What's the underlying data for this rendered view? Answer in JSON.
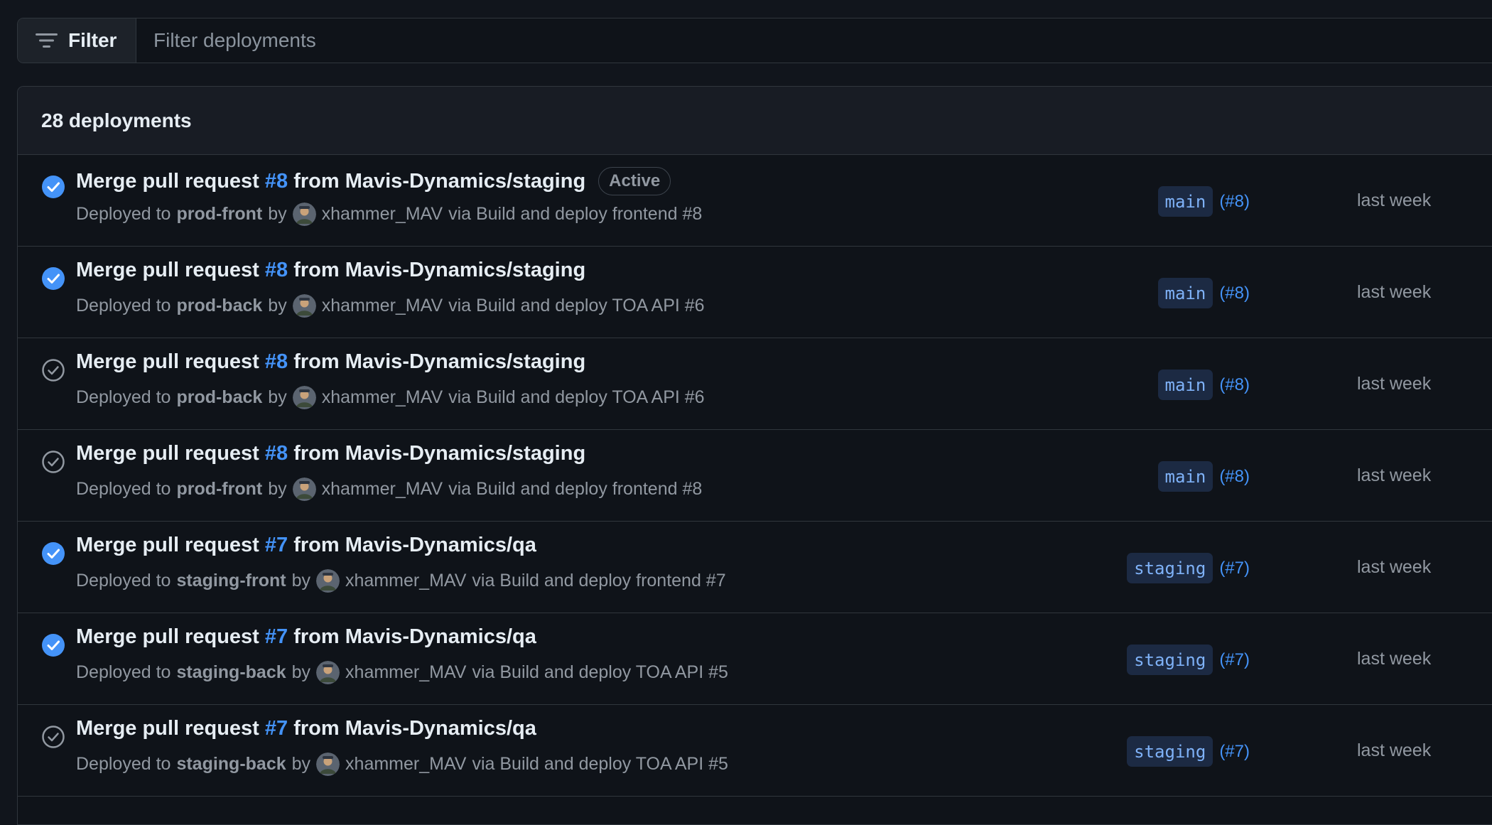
{
  "filter": {
    "button_label": "Filter",
    "placeholder": "Filter deployments"
  },
  "deployments": {
    "count_label": "28 deployments",
    "rows": [
      {
        "status": "active",
        "title_prefix": "Merge pull request ",
        "pr_number": "#8",
        "title_suffix": " from Mavis-Dynamics/staging",
        "badge": "Active",
        "deployed_to_prefix": "Deployed to",
        "environment": "prod-front",
        "by_text": "by",
        "user": "xhammer_MAV",
        "via_text": "via Build and deploy frontend #8",
        "branch": "main",
        "run": "(#8)",
        "time": "last week"
      },
      {
        "status": "active",
        "title_prefix": "Merge pull request ",
        "pr_number": "#8",
        "title_suffix": " from Mavis-Dynamics/staging",
        "badge": "",
        "deployed_to_prefix": "Deployed to",
        "environment": "prod-back",
        "by_text": "by",
        "user": "xhammer_MAV",
        "via_text": "via Build and deploy TOA API #6",
        "branch": "main",
        "run": "(#8)",
        "time": "last week"
      },
      {
        "status": "inactive",
        "title_prefix": "Merge pull request ",
        "pr_number": "#8",
        "title_suffix": " from Mavis-Dynamics/staging",
        "badge": "",
        "deployed_to_prefix": "Deployed to",
        "environment": "prod-back",
        "by_text": "by",
        "user": "xhammer_MAV",
        "via_text": "via Build and deploy TOA API #6",
        "branch": "main",
        "run": "(#8)",
        "time": "last week"
      },
      {
        "status": "inactive",
        "title_prefix": "Merge pull request ",
        "pr_number": "#8",
        "title_suffix": " from Mavis-Dynamics/staging",
        "badge": "",
        "deployed_to_prefix": "Deployed to",
        "environment": "prod-front",
        "by_text": "by",
        "user": "xhammer_MAV",
        "via_text": "via Build and deploy frontend #8",
        "branch": "main",
        "run": "(#8)",
        "time": "last week"
      },
      {
        "status": "active",
        "title_prefix": "Merge pull request ",
        "pr_number": "#7",
        "title_suffix": " from Mavis-Dynamics/qa",
        "badge": "",
        "deployed_to_prefix": "Deployed to",
        "environment": "staging-front",
        "by_text": "by",
        "user": "xhammer_MAV",
        "via_text": "via Build and deploy frontend #7",
        "branch": "staging",
        "run": "(#7)",
        "time": "last week"
      },
      {
        "status": "active",
        "title_prefix": "Merge pull request ",
        "pr_number": "#7",
        "title_suffix": " from Mavis-Dynamics/qa",
        "badge": "",
        "deployed_to_prefix": "Deployed to",
        "environment": "staging-back",
        "by_text": "by",
        "user": "xhammer_MAV",
        "via_text": "via Build and deploy TOA API #5",
        "branch": "staging",
        "run": "(#7)",
        "time": "last week"
      },
      {
        "status": "inactive",
        "title_prefix": "Merge pull request ",
        "pr_number": "#7",
        "title_suffix": " from Mavis-Dynamics/qa",
        "badge": "",
        "deployed_to_prefix": "Deployed to",
        "environment": "staging-back",
        "by_text": "by",
        "user": "xhammer_MAV",
        "via_text": "via Build and deploy TOA API #5",
        "branch": "staging",
        "run": "(#7)",
        "time": "last week"
      }
    ]
  },
  "icons": {
    "filter": "filter-lines-icon",
    "active_status": "check-circle-fill-icon",
    "inactive_status": "check-circle-outline-icon"
  },
  "colors": {
    "background": "#11151c",
    "accent_link": "#4493f8",
    "active_check": "#4493f8",
    "inactive_check": "#9198a1",
    "branch_bg": "#1c2a43"
  }
}
